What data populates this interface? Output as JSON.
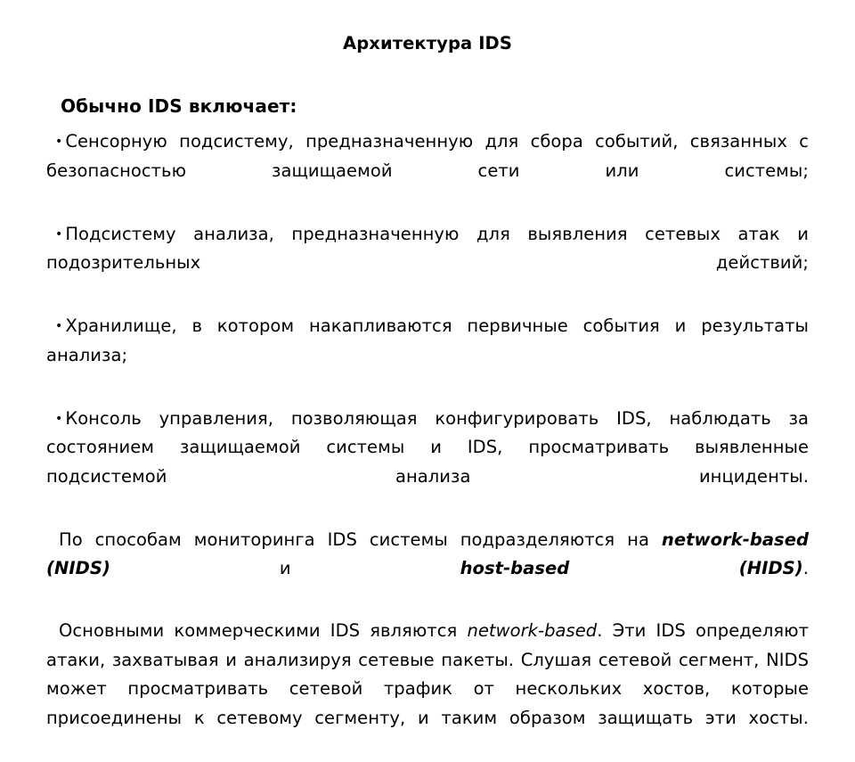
{
  "slide": {
    "title": "Архитектура IDS",
    "lead": "Обычно IDS включает:",
    "bullet_glyph": "•",
    "bullets": [
      "Сенсорную подсистему, предназначенную для сбора событий, связанных с безопасностью защищаемой сети или системы;",
      "Подсистему анализа, предназначенную для выявления сетевых атак и подозрительных действий;",
      "Хранилище, в котором накапливаются первичные события и результаты анализа;",
      "Консоль управления, позволяющая конфигурировать IDS, наблюдать за состоянием защищаемой системы и IDS, просматривать выявленные подсистемой анализа инциденты."
    ],
    "paragraph_monitoring": {
      "part1": "По способам мониторинга IDS системы подразделяются на ",
      "emphasis1": "network-based (NIDS)",
      "part2": " и ",
      "emphasis2": "host-based (HIDS)",
      "part3": "."
    },
    "paragraph_commercial": {
      "part1": "Основными коммерческими IDS являются ",
      "emphasis1": "network-based",
      "part2": ". Эти IDS определяют атаки, захватывая и анализируя сетевые пакеты. Слушая сетевой сегмент, NIDS может просматривать сетевой трафик от нескольких хостов, которые присоединены к сетевому сегменту, и таким образом защищать эти хосты."
    }
  }
}
